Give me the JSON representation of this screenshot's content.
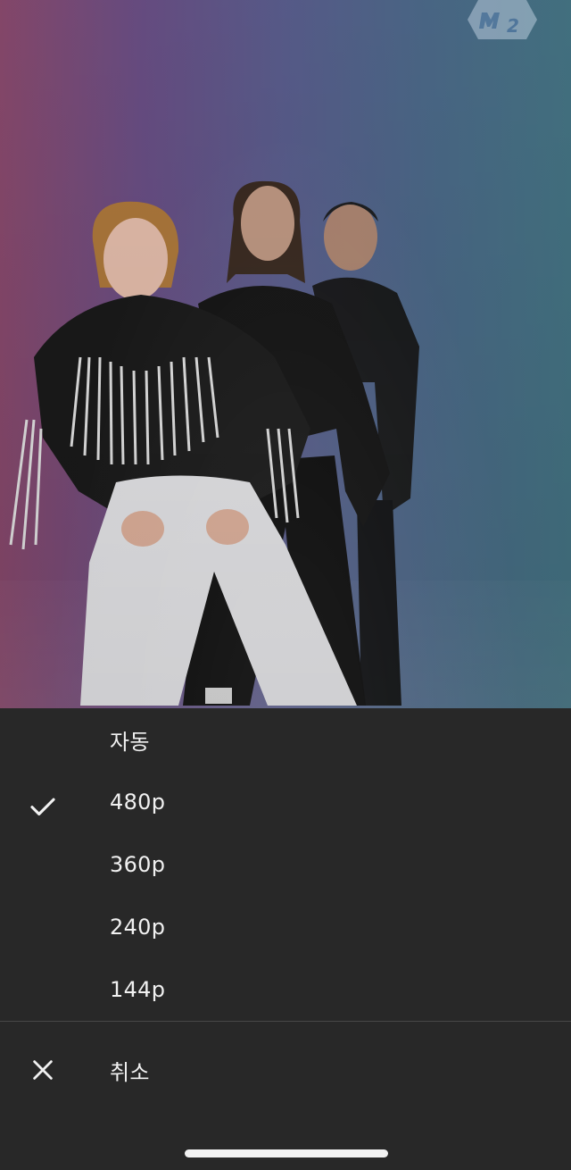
{
  "video": {
    "channel_logo_icon": "mnet-m2-logo-icon"
  },
  "quality_menu": {
    "options": [
      {
        "label": "자동",
        "selected": false
      },
      {
        "label": "480p",
        "selected": true
      },
      {
        "label": "360p",
        "selected": false
      },
      {
        "label": "240p",
        "selected": false
      },
      {
        "label": "144p",
        "selected": false
      }
    ],
    "selected_icon": "checkmark-icon",
    "cancel": {
      "label": "취소",
      "icon": "close-icon"
    }
  },
  "colors": {
    "sheet_background": "#282828",
    "text": "#f1f1f1",
    "divider": "#464646"
  }
}
